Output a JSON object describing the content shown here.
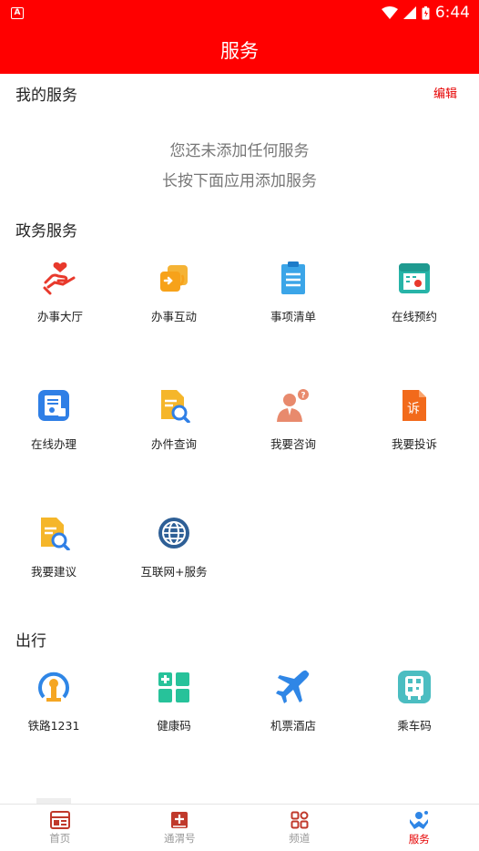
{
  "status_bar": {
    "time": "6:44"
  },
  "app_bar": {
    "title": "服务"
  },
  "my_services": {
    "title": "我的服务",
    "edit_label": "编辑",
    "empty_line1": "您还未添加任何服务",
    "empty_line2": "长按下面应用添加服务"
  },
  "gov_services": {
    "title": "政务服务",
    "items": [
      {
        "label": "办事大厅",
        "icon": "heart-hand-icon"
      },
      {
        "label": "办事互动",
        "icon": "exchange-icon"
      },
      {
        "label": "事项清单",
        "icon": "clipboard-list-icon"
      },
      {
        "label": "在线预约",
        "icon": "calendar-icon"
      },
      {
        "label": "在线办理",
        "icon": "online-process-icon"
      },
      {
        "label": "办件查询",
        "icon": "document-search-icon"
      },
      {
        "label": "我要咨询",
        "icon": "person-question-icon"
      },
      {
        "label": "我要投诉",
        "icon": "complaint-icon"
      },
      {
        "label": "我要建议",
        "icon": "suggestion-icon"
      },
      {
        "label": "互联网+服务",
        "icon": "globe-icon"
      }
    ]
  },
  "travel": {
    "title": "出行",
    "items": [
      {
        "label": "铁路1231",
        "icon": "railway-icon"
      },
      {
        "label": "健康码",
        "icon": "health-code-icon"
      },
      {
        "label": "机票酒店",
        "icon": "airplane-icon"
      },
      {
        "label": "乘车码",
        "icon": "ride-code-icon"
      }
    ]
  },
  "bottom_nav": {
    "items": [
      {
        "label": "首页",
        "icon": "home-icon",
        "active": false
      },
      {
        "label": "通渭号",
        "icon": "plus-square-icon",
        "active": false
      },
      {
        "label": "频道",
        "icon": "channel-grid-icon",
        "active": false
      },
      {
        "label": "服务",
        "icon": "service-icon",
        "active": true
      }
    ]
  },
  "colors": {
    "brand": "#ff0000",
    "accent_text": "#e60000"
  }
}
